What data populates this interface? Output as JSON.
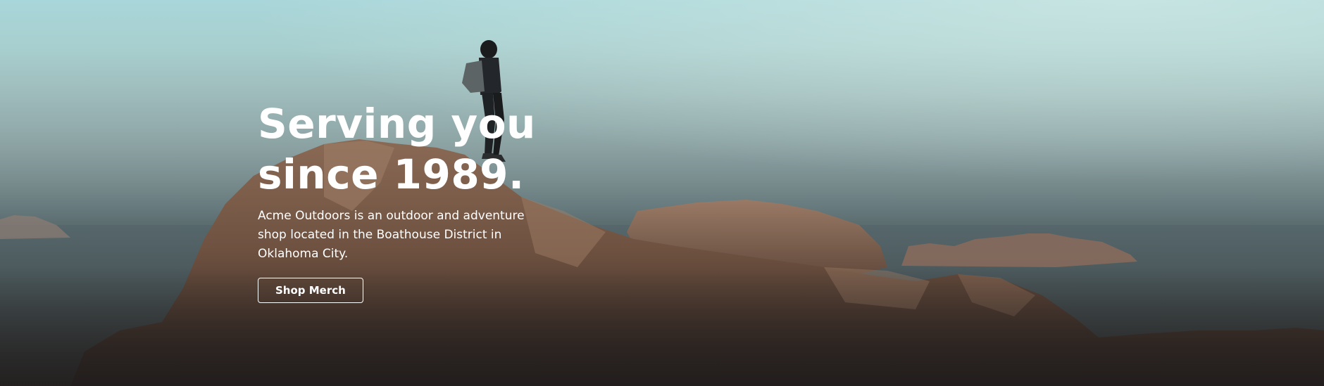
{
  "hero": {
    "headline_line1": "Serving you",
    "headline_line2": "since 1989.",
    "description": "Acme Outdoors is an outdoor and adventure shop located in the Boathouse District in Oklahoma City.",
    "cta_label": "Shop Merch",
    "background_image": "hiker-on-rocks-photo"
  }
}
